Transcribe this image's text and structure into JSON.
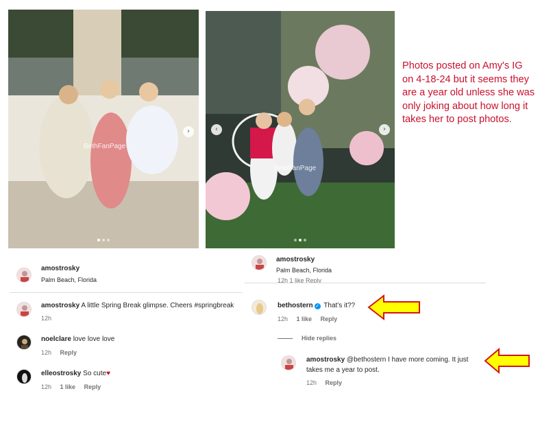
{
  "photos": [
    {
      "watermark": "BethFanPage"
    },
    {
      "watermark": "BethFanPage"
    }
  ],
  "caption": "Photos posted on Amy's IG on 4-18-24 but it seems they are a year old unless she was only joking about how long it takes her to post photos.",
  "left_post": {
    "header": {
      "username": "amostrosky",
      "location": "Palm Beach, Florida"
    },
    "comments": [
      {
        "username": "amostrosky",
        "text": "A little Spring Break glimpse. Cheers #springbreak",
        "time": "12h"
      },
      {
        "username": "noelclare",
        "text": "love love love",
        "time": "12h",
        "reply": "Reply"
      },
      {
        "username": "elleostrosky",
        "text": "So cute",
        "emoji": "♥",
        "time": "12h",
        "likes": "1 like",
        "reply": "Reply"
      }
    ]
  },
  "right_post": {
    "header": {
      "username": "amostrosky",
      "location": "Palm Beach, Florida",
      "cut_row": "12h   1 like   Reply"
    },
    "comment": {
      "username": "bethostern",
      "text": "That's it??",
      "time": "12h",
      "likes": "1 like",
      "reply": "Reply"
    },
    "hide_replies": "Hide replies",
    "reply": {
      "username": "amostrosky",
      "text_line1": "@bethostern I have more coming. It just",
      "text_line2": "takes me a year to post.",
      "time": "12h",
      "reply": "Reply"
    }
  },
  "colors": {
    "caption": "#c8102e",
    "arrow_fill": "#ffff00",
    "arrow_stroke": "#d4141c",
    "verified": "#0095f6"
  },
  "icons": [
    "chevron-right-icon",
    "chevron-left-icon",
    "verified-badge-icon",
    "heart-icon",
    "arrow-left-icon"
  ]
}
